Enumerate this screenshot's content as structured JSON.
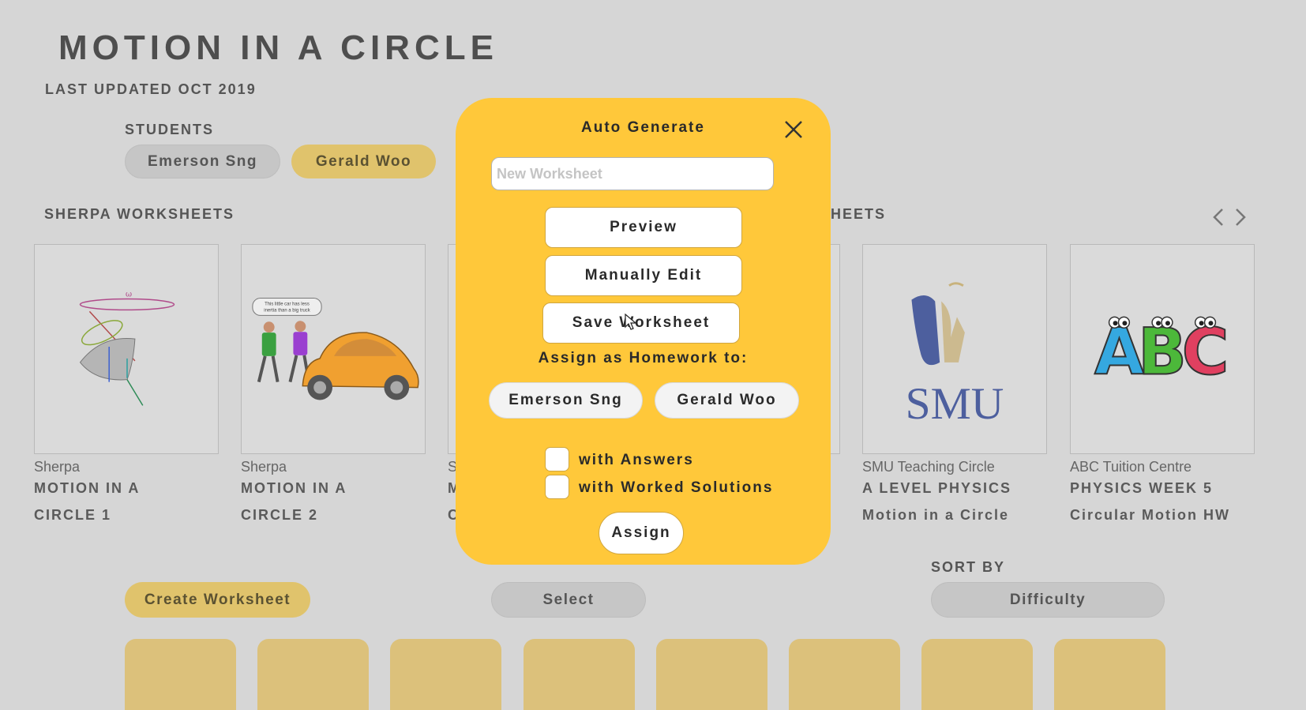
{
  "page": {
    "title": "MOTION IN A CIRCLE",
    "subtitle": "LAST UPDATED OCT 2019"
  },
  "students": {
    "label": "STUDENTS",
    "items": [
      {
        "name": "Emerson Sng",
        "selected": false
      },
      {
        "name": "Gerald Woo",
        "selected": true
      }
    ]
  },
  "sherpa_section": {
    "label": "SHERPA WORKSHEETS",
    "cards": [
      {
        "publisher": "Sherpa",
        "title_line1": "MOTION IN A",
        "title_line2": "CIRCLE 1",
        "icon": "conical-pendulum-image"
      },
      {
        "publisher": "Sherpa",
        "title_line1": "MOTION IN A",
        "title_line2": "CIRCLE 2",
        "icon": "car-and-kids-image",
        "bubble_line1": "This little car has less",
        "bubble_line2": "inertia than a big truck"
      },
      {
        "publisher_partial": "S",
        "title_partial1": "M",
        "title_partial2": "C"
      }
    ]
  },
  "community_section": {
    "label_partial": "HEETS",
    "cards": [
      {
        "publisher": "SMU Teaching Circle",
        "title_line1": "A LEVEL PHYSICS",
        "title_line2": "Motion in a Circle",
        "icon": "smu-logo",
        "logo_text": "SMU"
      },
      {
        "publisher": "ABC Tuition Centre",
        "title_line1": "PHYSICS WEEK 5",
        "title_line2": "Circular Motion HW",
        "icon": "abc-logo",
        "logo_text": "ABC"
      }
    ],
    "prev_icon": "chevron-left-icon",
    "next_icon": "chevron-right-icon"
  },
  "actions": {
    "create_label": "Create Worksheet",
    "select_label": "Select",
    "sort_label": "SORT BY",
    "sort_value": "Difficulty"
  },
  "modal": {
    "title": "Auto Generate",
    "close_icon": "close-icon",
    "name_placeholder": "New Worksheet",
    "preview_label": "Preview",
    "edit_label": "Manually Edit",
    "save_label": "Save Worksheet",
    "assign_heading": "Assign as Homework to:",
    "students": [
      "Emerson Sng",
      "Gerald Woo"
    ],
    "with_answers_label": "with Answers",
    "with_solutions_label": "with Worked Solutions",
    "assign_label": "Assign"
  },
  "colors": {
    "background": "#d6d6d6",
    "modal": "#ffc83a",
    "gold_pill": "#e0c36c",
    "tile": "#dcc17b"
  }
}
